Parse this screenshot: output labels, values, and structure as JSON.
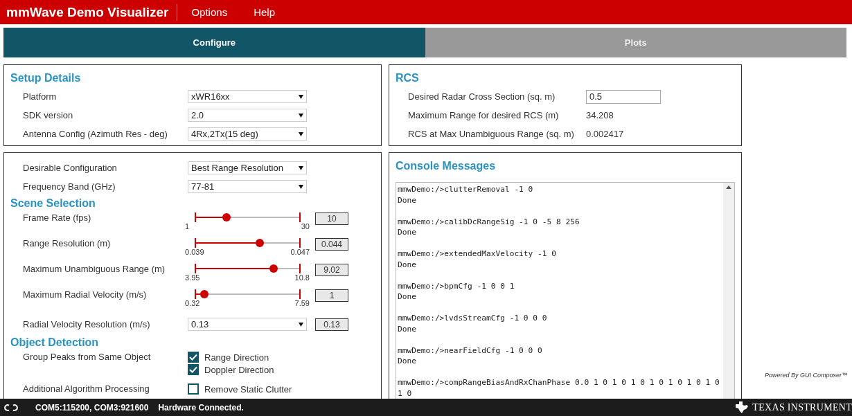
{
  "app_title": "mmWave Demo Visualizer",
  "menu": [
    "Options",
    "Help"
  ],
  "tabs": [
    {
      "label": "Configure",
      "selected": true
    },
    {
      "label": "Plots",
      "selected": false
    }
  ],
  "setup": {
    "title": "Setup Details",
    "rows": [
      {
        "label": "Platform",
        "value": "xWR16xx"
      },
      {
        "label": "SDK version",
        "value": "2.0"
      },
      {
        "label": "Antenna Config (Azimuth Res - deg)",
        "value": "4Rx,2Tx(15 deg)"
      }
    ]
  },
  "config": {
    "rows": [
      {
        "label": "Desirable Configuration",
        "value": "Best Range Resolution"
      },
      {
        "label": "Frequency Band (GHz)",
        "value": "77-81"
      }
    ]
  },
  "scene": {
    "title": "Scene Selection",
    "rows": [
      {
        "kind": "slider",
        "label": "Frame Rate (fps)",
        "min": "1",
        "max": "30",
        "level": 0.3,
        "readout": "10"
      },
      {
        "kind": "slider",
        "label": "Range Resolution (m)",
        "min": "0.039",
        "max": "0.047",
        "level": 0.62,
        "readout": "0.044"
      },
      {
        "kind": "slider",
        "label": "Maximum Unambiguous Range (m)",
        "min": "3.95",
        "max": "10.8",
        "level": 0.75,
        "readout": "9.02"
      },
      {
        "kind": "slider",
        "label": "Maximum Radial Velocity (m/s)",
        "min": "0.32",
        "max": "7.59",
        "level": 0.09,
        "readout": "1"
      },
      {
        "kind": "select",
        "label": "Radial Velocity Resolution (m/s)",
        "value": "0.13",
        "readout": "0.13"
      }
    ]
  },
  "object_detection": {
    "title": "Object Detection",
    "rows": [
      {
        "label": "Group Peaks from Same Object",
        "options": [
          {
            "label": "Range Direction",
            "checked": true
          },
          {
            "label": "Doppler Direction",
            "checked": true
          }
        ]
      },
      {
        "label": "Additional Algorithm Processing",
        "options": [
          {
            "label": "Remove Static Clutter",
            "checked": false
          }
        ]
      }
    ]
  },
  "rcs": {
    "title": "RCS",
    "rows": [
      {
        "kind": "input",
        "label": "Desired Radar Cross Section (sq. m)",
        "value": "0.5"
      },
      {
        "kind": "text",
        "label": "Maximum Range for desired RCS (m)",
        "value": "34.208"
      },
      {
        "kind": "text",
        "label": "RCS at Max Unambiguous Range (sq. m)",
        "value": "0.002417"
      }
    ]
  },
  "console": {
    "title": "Console Messages",
    "entries": [
      {
        "command": "mmwDemo:/>clutterRemoval -1 0",
        "result": "Done"
      },
      {
        "command": "mmwDemo:/>calibDcRangeSig -1 0 -5 8 256",
        "result": "Done"
      },
      {
        "command": "mmwDemo:/>extendedMaxVelocity -1 0",
        "result": "Done"
      },
      {
        "command": "mmwDemo:/>bpmCfg -1 0 0 1",
        "result": "Done"
      },
      {
        "command": "mmwDemo:/>lvdsStreamCfg -1 0 0 0",
        "result": "Done"
      },
      {
        "command": "mmwDemo:/>nearFieldCfg -1 0 0 0",
        "result": "Done"
      },
      {
        "command": "mmwDemo:/>compRangeBiasAndRxChanPhase 0.0 1 0 1 0 1 0 1 0 1 0 1 0 1 0 1 0"
      }
    ]
  },
  "powered_by": "Powered By GUI Composer™",
  "status": {
    "ports": "COM5:115200, COM3:921600",
    "connection": "Hardware Connected."
  },
  "brand": "TEXAS INSTRUMENT"
}
